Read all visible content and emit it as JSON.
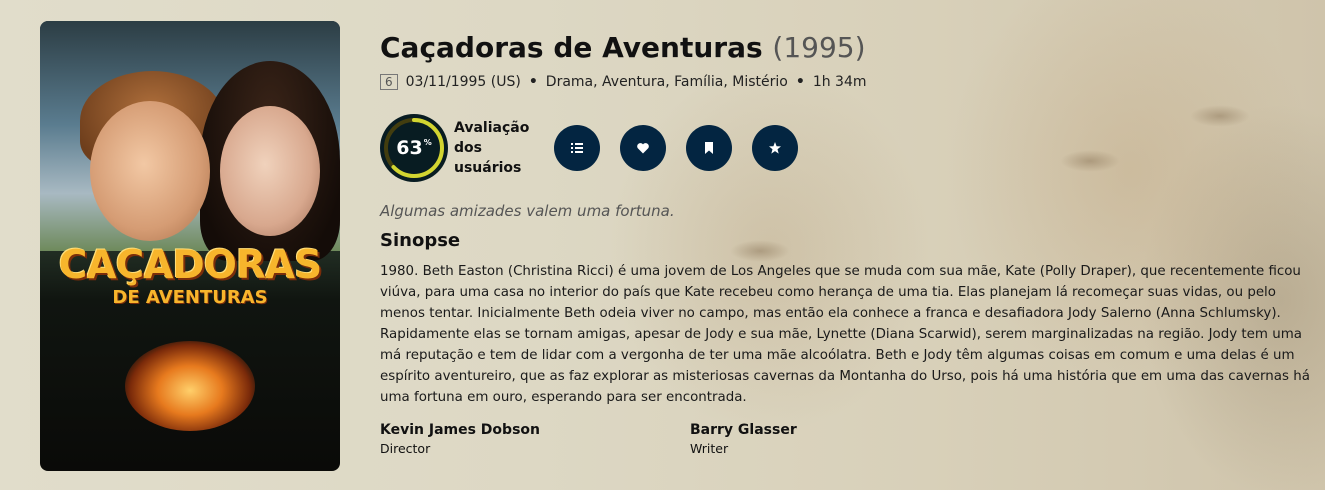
{
  "movie": {
    "title": "Caçadoras de Aventuras",
    "year": "(1995)",
    "certification": "6",
    "release": "03/11/1995 (US)",
    "genres": "Drama, Aventura, Família, Mistério",
    "runtime": "1h 34m",
    "tagline": "Algumas amizades valem uma fortuna.",
    "overview_heading": "Sinopse",
    "overview": "1980. Beth Easton (Christina Ricci) é uma jovem de Los Angeles que se muda com sua mãe, Kate (Polly Draper), que recentemente ficou viúva, para uma casa no interior do país que Kate recebeu como herança de uma tia. Elas planejam lá recomeçar suas vidas, ou pelo menos tentar. Inicialmente Beth odeia viver no campo, mas então ela conhece a franca e desafiadora Jody Salerno (Anna Schlumsky). Rapidamente elas se tornam amigas, apesar de Jody e sua mãe, Lynette (Diana Scarwid), serem marginalizadas na região. Jody tem uma má reputação e tem de lidar com a vergonha de ter uma mãe alcoólatra. Beth e Jody têm algumas coisas em comum e uma delas é um espírito aventureiro, que as faz explorar as misteriosas cavernas da Montanha do Urso, pois há uma história que em uma das cavernas há uma fortuna em ouro, esperando para ser encontrada."
  },
  "poster": {
    "title_line1": "CAÇADORAS",
    "title_line2": "DE AVENTURAS"
  },
  "score": {
    "value": 63,
    "unit": "%",
    "label_line1": "Avaliação",
    "label_line2": "dos",
    "label_line3": "usuários",
    "ring_color": "#d2d531",
    "track_color": "#423d0f"
  },
  "actions": [
    {
      "icon": "list-icon"
    },
    {
      "icon": "heart-icon"
    },
    {
      "icon": "bookmark-icon"
    },
    {
      "icon": "star-icon"
    }
  ],
  "crew": [
    {
      "name": "Kevin James Dobson",
      "role": "Director"
    },
    {
      "name": "Barry Glasser",
      "role": "Writer"
    }
  ],
  "colors": {
    "button_bg": "#032541",
    "score_bg": "#081c22"
  }
}
